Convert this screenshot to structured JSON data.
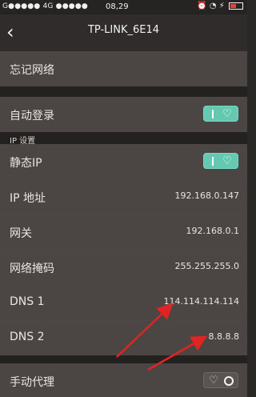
{
  "status_bar": {
    "left": "G●●●●● 4G ●●●●●",
    "time": "08,29",
    "right": "⏰ ◔ ⚡"
  },
  "nav": {
    "back_icon": "chevron-left-icon",
    "title": "TP-LINK_6E14"
  },
  "rows": {
    "forget_network": "忘记网络",
    "auto_login": "自动登录",
    "ip_section": "IP 设置",
    "static_ip": "静态IP",
    "ip_address_label": "IP 地址",
    "ip_address_value": "192.168.0.147",
    "gateway_label": "网关",
    "gateway_value": "192.168.0.1",
    "mask_label": "网络掩码",
    "mask_value": "255.255.255.0",
    "dns1_label": "DNS 1",
    "dns1_value": "114.114.114.114",
    "dns2_label": "DNS 2",
    "dns2_value": "8.8.8.8",
    "manual_proxy": "手动代理"
  },
  "colors": {
    "toggle_on": "#65c8b0",
    "annotation_arrow": "#e02424"
  }
}
